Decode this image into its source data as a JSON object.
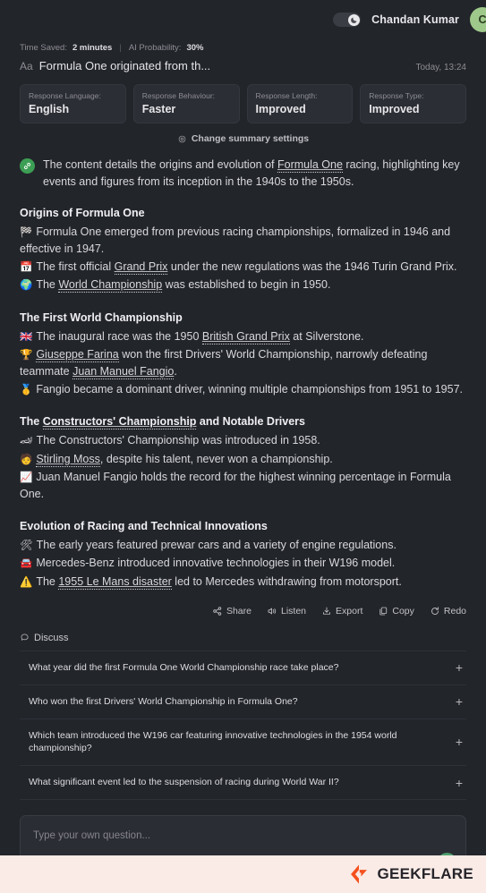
{
  "header": {
    "theme_toggle_icon": "moon-icon",
    "theme_toggle_state": "dark",
    "user_name": "Chandan Kumar",
    "avatar_initial": "C"
  },
  "meta": {
    "time_saved_label": "Time Saved:",
    "time_saved_value": "2 minutes",
    "separator": "|",
    "ai_probability_label": "AI Probability:",
    "ai_probability_value": "30%"
  },
  "document": {
    "font_icon": "Aa",
    "title": "Formula One originated from th...",
    "time": "Today, 13:24"
  },
  "settings_cards": [
    {
      "label": "Response Language:",
      "value": "English"
    },
    {
      "label": "Response Behaviour:",
      "value": "Faster"
    },
    {
      "label": "Response Length:",
      "value": "Improved"
    },
    {
      "label": "Response Type:",
      "value": "Improved"
    }
  ],
  "change_settings": {
    "icon": "gear-icon",
    "label": "Change summary settings"
  },
  "summary": {
    "intro_badge_icon": "brand-link-icon",
    "intro_parts": [
      {
        "text": "The content details the origins and evolution of "
      },
      {
        "text": "Formula One",
        "entity": true
      },
      {
        "text": " racing, highlighting key events and figures from its inception in the 1940s to the 1950s."
      }
    ],
    "sections": [
      {
        "heading": "Origins of Formula One",
        "heading_entity": false,
        "bullets": [
          {
            "icon": "🏁",
            "parts": [
              {
                "text": "Formula One emerged from previous racing championships, formalized in 1946 and effective in 1947."
              }
            ]
          },
          {
            "icon": "📅",
            "parts": [
              {
                "text": "The first official "
              },
              {
                "text": "Grand Prix",
                "entity": true
              },
              {
                "text": " under the new regulations was the 1946 Turin Grand Prix."
              }
            ]
          },
          {
            "icon": "🌍",
            "parts": [
              {
                "text": "The "
              },
              {
                "text": "World Championship",
                "entity": true
              },
              {
                "text": " was established to begin in 1950."
              }
            ]
          }
        ]
      },
      {
        "heading": "The First World Championship",
        "heading_entity": false,
        "bullets": [
          {
            "icon": "🇬🇧",
            "parts": [
              {
                "text": "The inaugural race was the 1950 "
              },
              {
                "text": "British Grand Prix",
                "entity": true
              },
              {
                "text": " at Silverstone."
              }
            ]
          },
          {
            "icon": "🏆",
            "parts": [
              {
                "text": ""
              },
              {
                "text": "Giuseppe Farina",
                "entity": true
              },
              {
                "text": " won the first Drivers' World Championship, narrowly defeating teammate "
              },
              {
                "text": "Juan Manuel Fangio",
                "entity": true
              },
              {
                "text": "."
              }
            ]
          },
          {
            "icon": "🥇",
            "parts": [
              {
                "text": "Fangio became a dominant driver, winning multiple championships from 1951 to 1957."
              }
            ]
          }
        ]
      },
      {
        "heading": "The Constructors' Championship and Notable Drivers",
        "heading_entity": true,
        "heading_entity_text": "Constructors' Championship",
        "heading_prefix": "The ",
        "heading_suffix": " and Notable Drivers",
        "bullets": [
          {
            "icon": "🏎",
            "parts": [
              {
                "text": "The Constructors' Championship was introduced in 1958."
              }
            ]
          },
          {
            "icon": "🧑",
            "parts": [
              {
                "text": ""
              },
              {
                "text": "Stirling Moss",
                "entity": true
              },
              {
                "text": ", despite his talent, never won a championship."
              }
            ]
          },
          {
            "icon": "📈",
            "parts": [
              {
                "text": "Juan Manuel Fangio holds the record for the highest winning percentage in Formula One."
              }
            ]
          }
        ]
      },
      {
        "heading": "Evolution of Racing and Technical Innovations",
        "heading_entity": false,
        "bullets": [
          {
            "icon": "🛠",
            "parts": [
              {
                "text": "The early years featured prewar cars and a variety of engine regulations."
              }
            ]
          },
          {
            "icon": "🚘",
            "parts": [
              {
                "text": "Mercedes-Benz introduced innovative technologies in their W196 model."
              }
            ]
          },
          {
            "icon": "⚠️",
            "parts": [
              {
                "text": "The "
              },
              {
                "text": "1955 Le Mans disaster",
                "entity": true
              },
              {
                "text": " led to Mercedes withdrawing from motorsport."
              }
            ]
          }
        ]
      }
    ]
  },
  "actions": [
    {
      "icon": "share-icon",
      "label": "Share"
    },
    {
      "icon": "listen-speaker-icon",
      "label": "Listen"
    },
    {
      "icon": "export-download-icon",
      "label": "Export"
    },
    {
      "icon": "copy-icon",
      "label": "Copy"
    },
    {
      "icon": "redo-icon",
      "label": "Redo"
    }
  ],
  "discuss": {
    "icon": "chat-bubble-icon",
    "label": "Discuss",
    "questions": [
      {
        "text": "What year did the first Formula One World Championship race take place?",
        "expand": "+"
      },
      {
        "text": "Who won the first Drivers' World Championship in Formula One?",
        "expand": "+"
      },
      {
        "text": "Which team introduced the W196 car featuring innovative technologies in the 1954 world championship?",
        "expand": "+"
      },
      {
        "text": "What significant event led to the suspension of racing during World War II?",
        "expand": "+"
      }
    ]
  },
  "composer": {
    "placeholder": "Type your own question...",
    "value": "",
    "send_icon": "arrow-up-icon"
  },
  "footer": {
    "logo_icon": "geekflare-mark-icon",
    "logo_text": "GEEKFLARE"
  },
  "colors": {
    "background": "#22252a",
    "card": "#2b2e34",
    "accent_green": "#3c9e54",
    "send_green": "#4f9e6d",
    "avatar_green": "#9ec98a",
    "footer_bg": "#faebe6",
    "logo_orange": "#f4511e"
  }
}
